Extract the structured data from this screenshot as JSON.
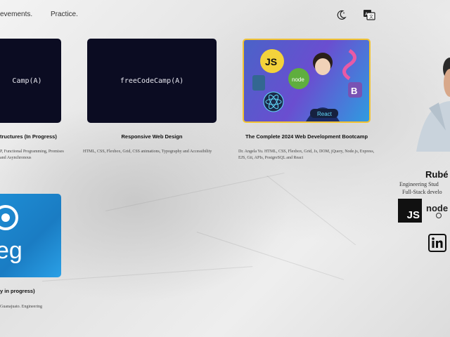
{
  "nav": {
    "link_achievements": "evements.",
    "link_practice": "Practice."
  },
  "icons": {
    "theme": "moon-star-icon",
    "language": "language-icon"
  },
  "cards": [
    {
      "thumb_text": "Camp(A)",
      "title": "tructures (In Progress)",
      "desc": "P, Functional Programming, Promises and Asynchronous"
    },
    {
      "thumb_text": "freeCodeCamp(A)",
      "title": "Responsive Web Design",
      "desc": "HTML, CSS, Flexbox, Grid, CSS animations, Typography and Accessibility"
    },
    {
      "thumb_labels": [
        "JS",
        "node",
        "React",
        "B"
      ],
      "title": "The Complete 2024 Web Development Bootcamp",
      "desc": "Dr. Angela Yu. HTML, CSS, Flexbox, Grid, Js, DOM, jQuery, Node.js, Express, EJS, Git, APIs, PostgreSQL and React"
    },
    {
      "thumb_text": "eg",
      "title": "y in progress)",
      "desc": "Guanajuato. Engineering"
    }
  ],
  "profile": {
    "name": "Rubé",
    "subtitle_1": "Engineering Stud",
    "subtitle_2": "Full-Stack develo",
    "badges": [
      "JS",
      "node"
    ]
  },
  "colors": {
    "card_dark": "#0b0c22",
    "udeg_blue": "#1e8fd6",
    "bootcamp_border": "#f1c232"
  }
}
